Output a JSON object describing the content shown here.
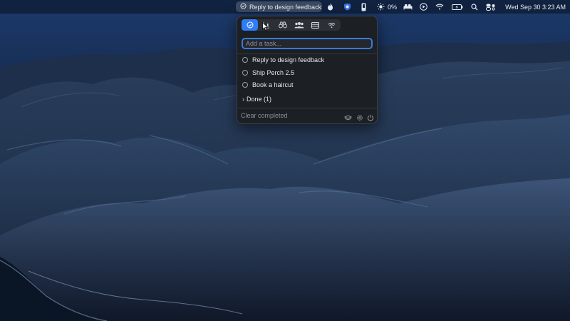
{
  "menubar": {
    "task_label": "Reply to design feedback",
    "battery_percent": "0%",
    "clock": "Wed Sep 30  3:23 AM",
    "icons": [
      "check-circle-icon",
      "flame-icon",
      "shield-icon",
      "phone-icon",
      "brightness-icon",
      "bed-icon",
      "play-icon",
      "wifi-icon",
      "battery-icon",
      "search-icon",
      "control-center-icon"
    ]
  },
  "popover": {
    "tabs": [
      {
        "name": "tasks",
        "icon": "check-circle-icon",
        "active": true
      },
      {
        "name": "stats",
        "icon": "chart-icon",
        "active": false
      },
      {
        "name": "focus",
        "icon": "binoculars-icon",
        "active": false
      },
      {
        "name": "team",
        "icon": "people-icon",
        "active": false
      },
      {
        "name": "list",
        "icon": "list-icon",
        "active": false
      },
      {
        "name": "network",
        "icon": "wifi-icon",
        "active": false
      }
    ],
    "input_placeholder": "Add a task...",
    "tasks": [
      {
        "label": "Reply to design feedback",
        "done": false
      },
      {
        "label": "Ship Perch 2.5",
        "done": false
      },
      {
        "label": "Book a haircut",
        "done": false
      }
    ],
    "done_label": "Done (1)",
    "clear_label": "Clear completed",
    "footer_icons": [
      "stack-icon",
      "gear-icon",
      "power-icon"
    ]
  },
  "colors": {
    "accent": "#2f7df6",
    "popover_bg": "#1c1f24",
    "wallpaper_sky": "#16305a"
  }
}
